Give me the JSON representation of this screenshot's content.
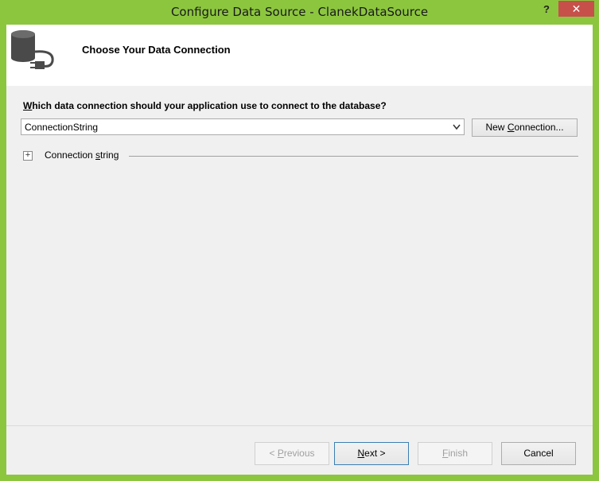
{
  "window": {
    "title": "Configure Data Source - ClanekDataSource",
    "help_label": "?",
    "close_label": "✕"
  },
  "header": {
    "title": "Choose Your Data Connection",
    "icon": "database-plug-icon"
  },
  "question": {
    "accel": "W",
    "rest": "hich data connection should your application use to connect to the database?"
  },
  "connection_select": {
    "value": "ConnectionString"
  },
  "new_connection_button": {
    "pre": "New ",
    "accel": "C",
    "post": "onnection..."
  },
  "connection_string_expander": {
    "symbol": "+",
    "pre": "Connection ",
    "accel": "s",
    "post": "tring"
  },
  "footer": {
    "previous": {
      "pre": "< ",
      "accel": "P",
      "post": "revious"
    },
    "next": {
      "accel": "N",
      "post": "ext >"
    },
    "finish": {
      "accel": "F",
      "post": "inish"
    },
    "cancel": "Cancel"
  },
  "colors": {
    "frame": "#8CC63F",
    "close": "#C7504B",
    "client": "#F0F0F0"
  }
}
